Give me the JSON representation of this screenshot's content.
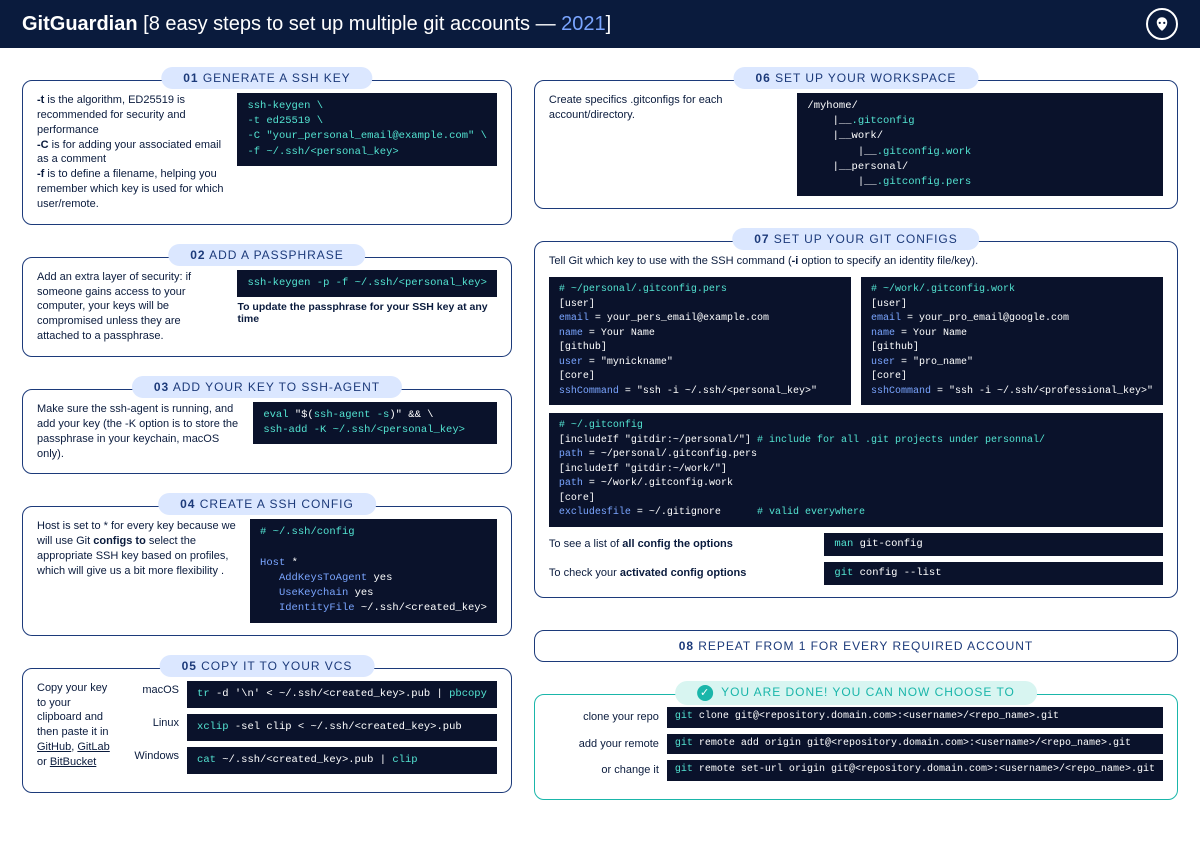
{
  "header": {
    "brand": "GitGuardian",
    "subtitle_pre": " [8 easy steps to set up multiple git accounts — ",
    "year": "2021",
    "subtitle_post": "]"
  },
  "s1": {
    "num": "01",
    "title": " GENERATE A SSH KEY",
    "line1a": "-t",
    "line1b": " is the algorithm, ED25519 is recommended for security and performance",
    "line2a": "-C",
    "line2b": " is for adding your associated email as a comment",
    "line3a": "-f",
    "line3b": " is to define a filename, helping you remember which key is used for which user/remote.",
    "code": "ssh-keygen \\\n-t ed25519 \\\n-C \"your_personal_email@example.com\" \\\n-f ~/.ssh/<personal_key>"
  },
  "s2": {
    "num": "02",
    "title": " ADD A PASSPHRASE",
    "desc": "Add an extra layer of security:  if someone gains access to your computer, your keys will be compromised unless they are attached to a passphrase.",
    "code": "ssh-keygen -p -f ~/.ssh/<personal_key>",
    "sub": "To update the passphrase for your SSH key at any time"
  },
  "s3": {
    "num": "03",
    "title": " ADD YOUR KEY TO SSH-AGENT",
    "desc": "Make sure the ssh-agent is running, and add your key (the -K option is to store the passphrase in your keychain, macOS only).",
    "code_a": "eval ",
    "code_b": "\"$(",
    "code_c": "ssh-agent -s",
    "code_d": ")\"",
    "code_e": " && \\\n",
    "code_f": "ssh-add -K ~/.ssh/<personal_key>"
  },
  "s4": {
    "num": "04",
    "title": " CREATE A SSH CONFIG",
    "desc_a": "Host is set to * for every key because we will use Git ",
    "desc_b": "configs to",
    "desc_c": " select the appropriate SSH key based on profiles, which will give us a bit more flexibility .",
    "code_comment": "# ~/.ssh/config",
    "code_body_a": "Host",
    "code_body_b": " *\n   ",
    "code_body_c": "AddKeysToAgent",
    "code_body_d": " yes\n   ",
    "code_body_e": "UseKeychain",
    "code_body_f": " yes\n   ",
    "code_body_g": "IdentityFile",
    "code_body_h": " ~/.ssh/<created_key>"
  },
  "s5": {
    "num": "05",
    "title": " COPY IT TO YOUR VCS",
    "desc_a": "Copy your key to your clipboard and then paste it in ",
    "desc_links": "GitHub, GitLab or BitBucket",
    "links": {
      "github": "GitHub",
      "gitlab": "GitLab",
      "bitbucket": "BitBucket",
      "or": " or ",
      "sep": ", "
    },
    "os1": "macOS",
    "os2": "Linux",
    "os3": "Windows",
    "c1a": "tr",
    "c1b": " -d '\\n' < ~/.ssh/<created_key>.pub | ",
    "c1c": "pbcopy",
    "c2a": "xclip",
    "c2b": " -sel clip < ~/.ssh/<created_key>.pub",
    "c3a": "cat",
    "c3b": " ~/.ssh/<created_key>.pub | ",
    "c3c": "clip"
  },
  "s6": {
    "num": "06",
    "title": " SET UP YOUR WORKSPACE",
    "desc": "Create specifics .gitconfigs for each account/directory.",
    "code_a": "/myhome/\n    |__",
    "code_b": ".gitconfig",
    "code_c": "\n    |__work/\n        |__",
    "code_d": ".gitconfig.work",
    "code_e": "\n    |__personal/\n        |__",
    "code_f": ".gitconfig.pers"
  },
  "s7": {
    "num": "07",
    "title": " SET UP YOUR GIT CONFIGS",
    "desc_a": "Tell Git which key to use with the SSH command (",
    "desc_b": "-i",
    "desc_c": " option to specify an identity file/key).",
    "leftc": "# ~/personal/.gitconfig.pers",
    "rightc": "# ~/work/.gitconfig.work",
    "user": "[user]",
    "email": "email",
    "lemail": " = your_pers_email@example.com",
    "remail": " = your_pro_email@google.com",
    "name": "name",
    "nval": " = Your Name",
    "github": "[github]",
    "userk": "user",
    "luser": " = \"mynickname\"",
    "ruser": " = \"pro_name\"",
    "core": "[core]",
    "sshk": "sshCommand",
    "lssh": " = \"ssh -i ~/.ssh/<personal_key>\"",
    "rssh": " = \"ssh -i ~/.ssh/<professional_key>\"",
    "gc_comment": "# ~/.gitconfig",
    "gc_inc1a": "[includeIf \"gitdir:~/personal/\"]",
    "gc_inc1b": " # include for all .git projects under personnal/",
    "gc_path": "path",
    "gc_p1": " = ~/personal/.gitconfig.pers",
    "gc_inc2": "[includeIf \"gitdir:~/work/\"]",
    "gc_p2": " = ~/work/.gitconfig.work",
    "gc_excl": "excludesfile",
    "gc_exclv": " = ~/.gitignore",
    "gc_valid": "      # valid everywhere",
    "n1a": "To see a list of ",
    "n1b": "all config the options",
    "n2a": "To check your ",
    "n2b": "activated config options",
    "cmd1a": "man ",
    "cmd1b": "git-config",
    "cmd2a": "git ",
    "cmd2b": "config --list"
  },
  "s8": {
    "num": "08",
    "title": " REPEAT FROM 1 FOR EVERY REQUIRED ACCOUNT"
  },
  "done": {
    "title": " YOU ARE DONE! YOU CAN NOW CHOOSE TO",
    "r1l": "clone your repo",
    "r1a": "git ",
    "r1b": "clone git@<repository.domain.com>:<username>/<repo_name>.git",
    "r2l": "add your remote",
    "r2a": "git ",
    "r2b": "remote add origin git@<repository.domain.com>:<username>/<repo_name>.git",
    "r3l": "or change it",
    "r3a": "git ",
    "r3b": "remote set-url origin git@<repository.domain.com>:<username>/<repo_name>.git"
  }
}
